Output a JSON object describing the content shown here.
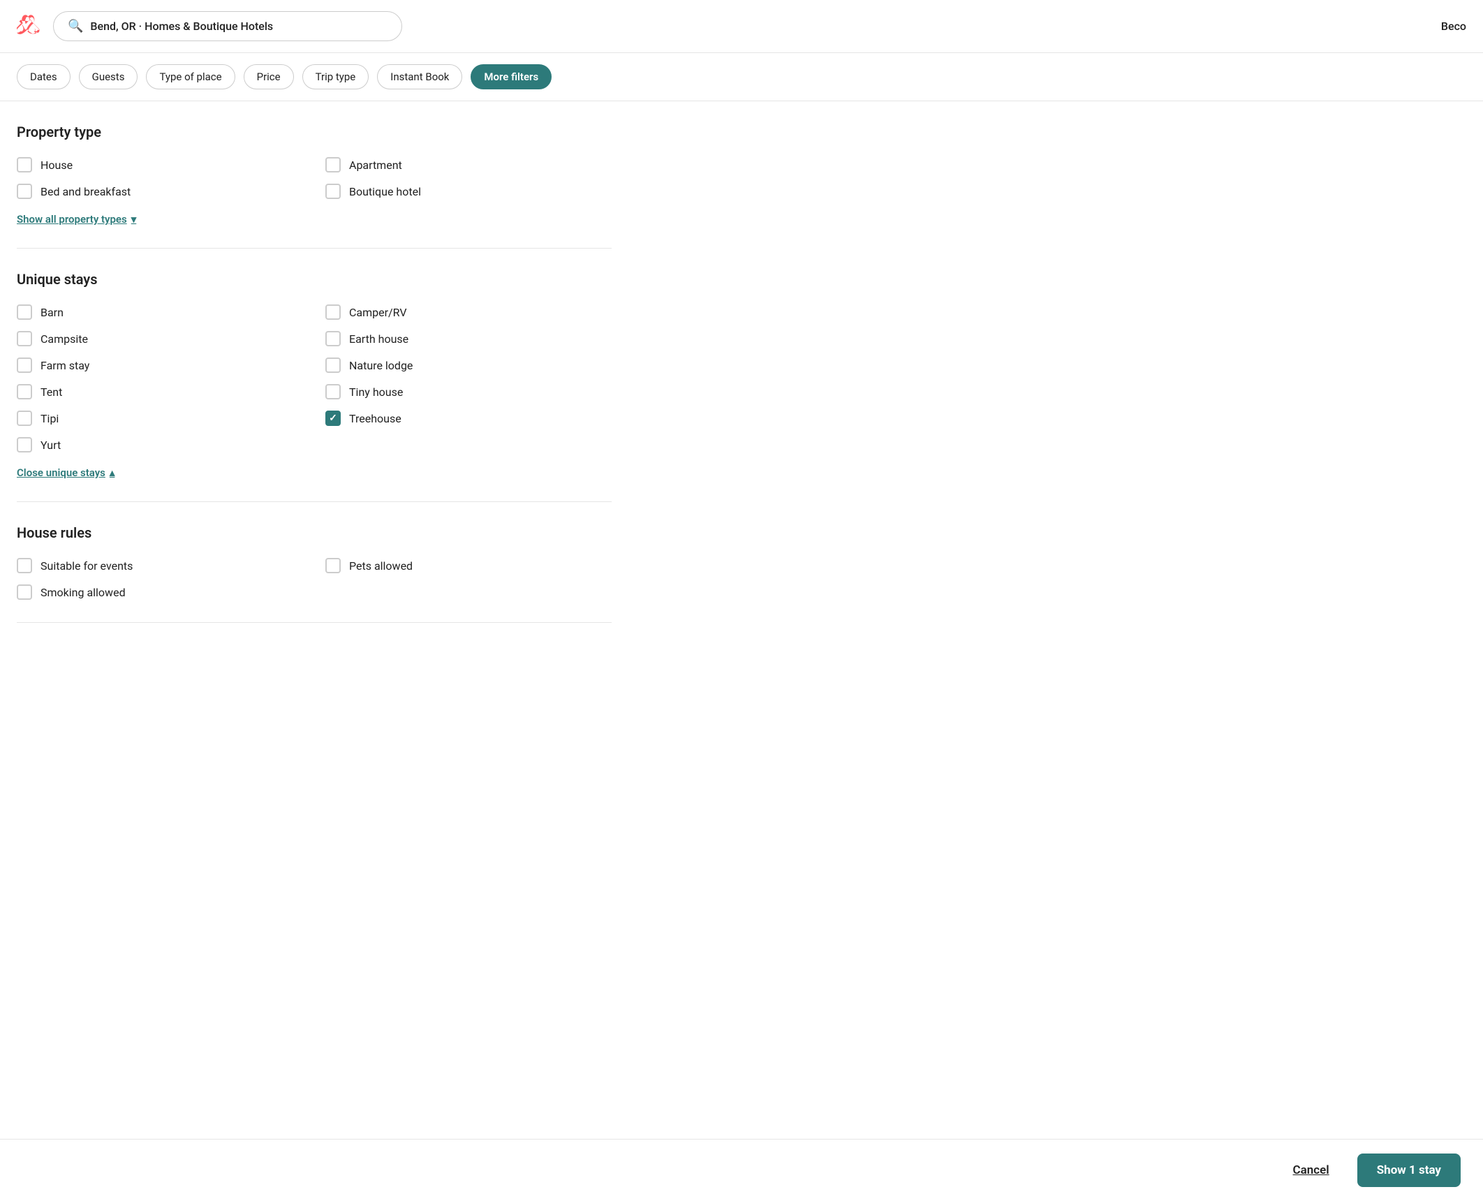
{
  "header": {
    "logo_alt": "Airbnb logo",
    "search_text": "Bend, OR · Homes & Boutique Hotels",
    "search_icon": "🔍",
    "user_name": "Beco"
  },
  "filter_bar": {
    "buttons": [
      {
        "id": "dates",
        "label": "Dates",
        "active": false
      },
      {
        "id": "guests",
        "label": "Guests",
        "active": false
      },
      {
        "id": "type-of-place",
        "label": "Type of place",
        "active": false
      },
      {
        "id": "price",
        "label": "Price",
        "active": false
      },
      {
        "id": "trip-type",
        "label": "Trip type",
        "active": false
      },
      {
        "id": "instant-book",
        "label": "Instant Book",
        "active": false
      },
      {
        "id": "more-filters",
        "label": "More filters",
        "active": true
      }
    ]
  },
  "property_type": {
    "section_title": "Property type",
    "items_left": [
      {
        "id": "house",
        "label": "House",
        "checked": false
      },
      {
        "id": "bed-and-breakfast",
        "label": "Bed and breakfast",
        "checked": false
      }
    ],
    "items_right": [
      {
        "id": "apartment",
        "label": "Apartment",
        "checked": false
      },
      {
        "id": "boutique-hotel",
        "label": "Boutique hotel",
        "checked": false
      }
    ],
    "show_all_label": "Show all property types",
    "show_all_icon": "▾"
  },
  "unique_stays": {
    "section_title": "Unique stays",
    "items_left": [
      {
        "id": "barn",
        "label": "Barn",
        "checked": false
      },
      {
        "id": "campsite",
        "label": "Campsite",
        "checked": false
      },
      {
        "id": "farm-stay",
        "label": "Farm stay",
        "checked": false
      },
      {
        "id": "tent",
        "label": "Tent",
        "checked": false
      },
      {
        "id": "tipi",
        "label": "Tipi",
        "checked": false
      },
      {
        "id": "yurt",
        "label": "Yurt",
        "checked": false
      }
    ],
    "items_right": [
      {
        "id": "camper-rv",
        "label": "Camper/RV",
        "checked": false
      },
      {
        "id": "earth-house",
        "label": "Earth house",
        "checked": false
      },
      {
        "id": "nature-lodge",
        "label": "Nature lodge",
        "checked": false
      },
      {
        "id": "tiny-house",
        "label": "Tiny house",
        "checked": false
      },
      {
        "id": "treehouse",
        "label": "Treehouse",
        "checked": true
      }
    ],
    "close_label": "Close unique stays",
    "close_icon": "▴"
  },
  "house_rules": {
    "section_title": "House rules",
    "items_left": [
      {
        "id": "suitable-for-events",
        "label": "Suitable for events",
        "checked": false
      },
      {
        "id": "smoking-allowed",
        "label": "Smoking allowed",
        "checked": false
      }
    ],
    "items_right": [
      {
        "id": "pets-allowed",
        "label": "Pets allowed",
        "checked": false
      }
    ]
  },
  "footer": {
    "cancel_label": "Cancel",
    "show_label": "Show 1 stay"
  },
  "colors": {
    "teal": "#2d7a7a",
    "teal_hover": "#236060"
  }
}
